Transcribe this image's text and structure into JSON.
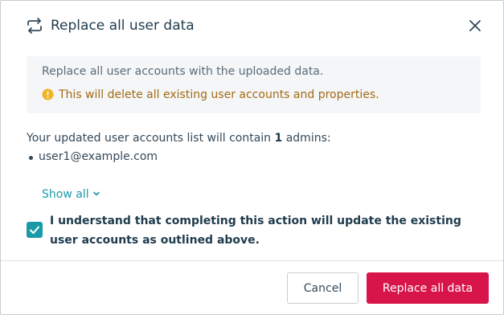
{
  "dialog": {
    "title": "Replace all user data",
    "title_icon": "sync-arrows-icon",
    "close_icon": "close-icon"
  },
  "info": {
    "description": "Replace all user accounts with the uploaded data.",
    "warning": "This will delete all existing user accounts and properties.",
    "warning_icon": "warning-icon",
    "warning_color": "#a36a12"
  },
  "summary": {
    "prefix": "Your updated user accounts list will contain ",
    "count": "1",
    "suffix": " admins:",
    "admins": [
      "user1@example.com"
    ]
  },
  "show_all": {
    "label": "Show all",
    "icon": "chevron-down-icon"
  },
  "consent": {
    "checked": true,
    "label": "I understand that completing this action will update the existing user accounts as outlined above."
  },
  "footer": {
    "cancel_label": "Cancel",
    "confirm_label": "Replace all data"
  },
  "colors": {
    "accent": "#1a9aa8",
    "danger": "#d8154a"
  }
}
